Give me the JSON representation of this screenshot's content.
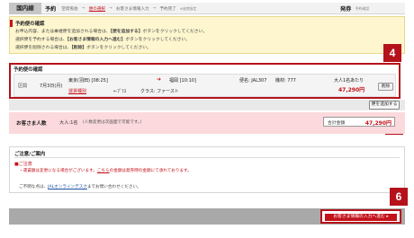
{
  "header": {
    "tab_domestic": "国内線",
    "yoyaku": "予約",
    "crumbs": [
      "空席照会",
      "便の選択",
      "お客さま情報入力",
      "予約完了"
    ],
    "crumb_note": "※座席指定",
    "hasso": "発券",
    "hasso_step": "予約確認"
  },
  "info": {
    "title": "予約便の確認",
    "lines": [
      {
        "pre": "お申込内容、または乗継便を追加される場合は、",
        "hl": "【便を追加する】",
        "post": "ボタンをクリックしてください。"
      },
      {
        "pre": "選択便を予約する場合は、",
        "hl": "【お客さま情報の入力へ進む】",
        "post": "ボタンをクリックしてください。"
      },
      {
        "pre": "選択便を削除される場合は、",
        "hl": "【削除】",
        "post": "ボタンをクリックしてください。"
      }
    ]
  },
  "flight": {
    "title": "予約便の確認",
    "section_label": "区間",
    "date": "7月3日(月)",
    "departure": "東京(羽田) [08:25]",
    "arrow": "➜",
    "arrival": "福岡 [10:10]",
    "flight_no": "便名: JAL307",
    "equipment": "機材: 777",
    "fare_label": "運賃種別",
    "fare_value": "←ﾌﾞﾗｽ",
    "class_label": "クラス: ファースト",
    "pax": "大人1名あたり",
    "price": "47,290円",
    "delete_label": "削除"
  },
  "add": {
    "button_label": "便を追加する"
  },
  "passengers": {
    "label": "お客さま人数",
    "count": "大人:1名",
    "note": "(人数変更は次画面で可能です。)",
    "total_label": "合計金額",
    "total_value": "47,290円"
  },
  "notes": {
    "title": "ご注意/ご案内",
    "head": "■ご注意",
    "line1_pre": "・運賃額は変更になる場合がございます。",
    "line1_link": "こちら",
    "line1_post": "の金額は発券時の金額にて承れております。",
    "contact_pre": "ご不明な点は、",
    "contact_link": "JALオンラインデスク",
    "contact_post": "までお問い合わせください。"
  },
  "next": {
    "button_label": "お客さま情報の入力へ進む ▸"
  },
  "badges": {
    "four": "4",
    "five": "5",
    "six": "6"
  },
  "colors": {
    "accent": "#b5121b",
    "price": "#c4121a",
    "info_bg": "#fdf6cf",
    "pax_bg": "#fcd9dc"
  }
}
